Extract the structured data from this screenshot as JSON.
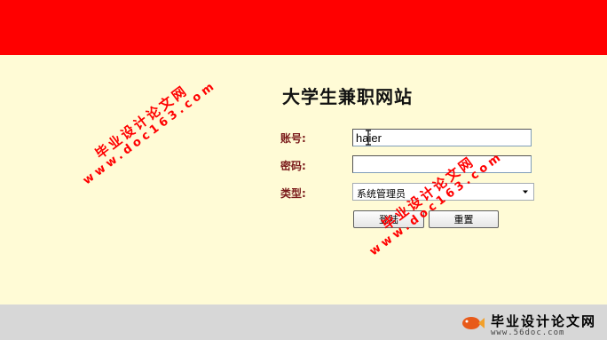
{
  "page": {
    "title": "大学生兼职网站"
  },
  "login_form": {
    "account_label": "账号:",
    "account_value": "haier",
    "password_label": "密码:",
    "password_value": "",
    "type_label": "类型:",
    "type_selected": "系统管理员",
    "login_button": "登陆",
    "reset_button": "重置"
  },
  "watermarks": [
    {
      "line1": "毕业设计论文网",
      "line2": "www.doc163.com"
    },
    {
      "line1": "毕业设计论文网",
      "line2": "www.doc163.com"
    }
  ],
  "footer_logo": {
    "text": "毕业设计论文网",
    "url": "www.56doc.com"
  },
  "colors": {
    "banner": "#ff0000",
    "background": "#fffbd6",
    "footer": "#d7d7d7",
    "label": "#7a1a1a",
    "watermark": "#ff0000"
  },
  "icons": {
    "select_arrow": "chevron-down-icon",
    "text_cursor": "text-cursor-icon",
    "logo": "fish-logo-icon"
  }
}
